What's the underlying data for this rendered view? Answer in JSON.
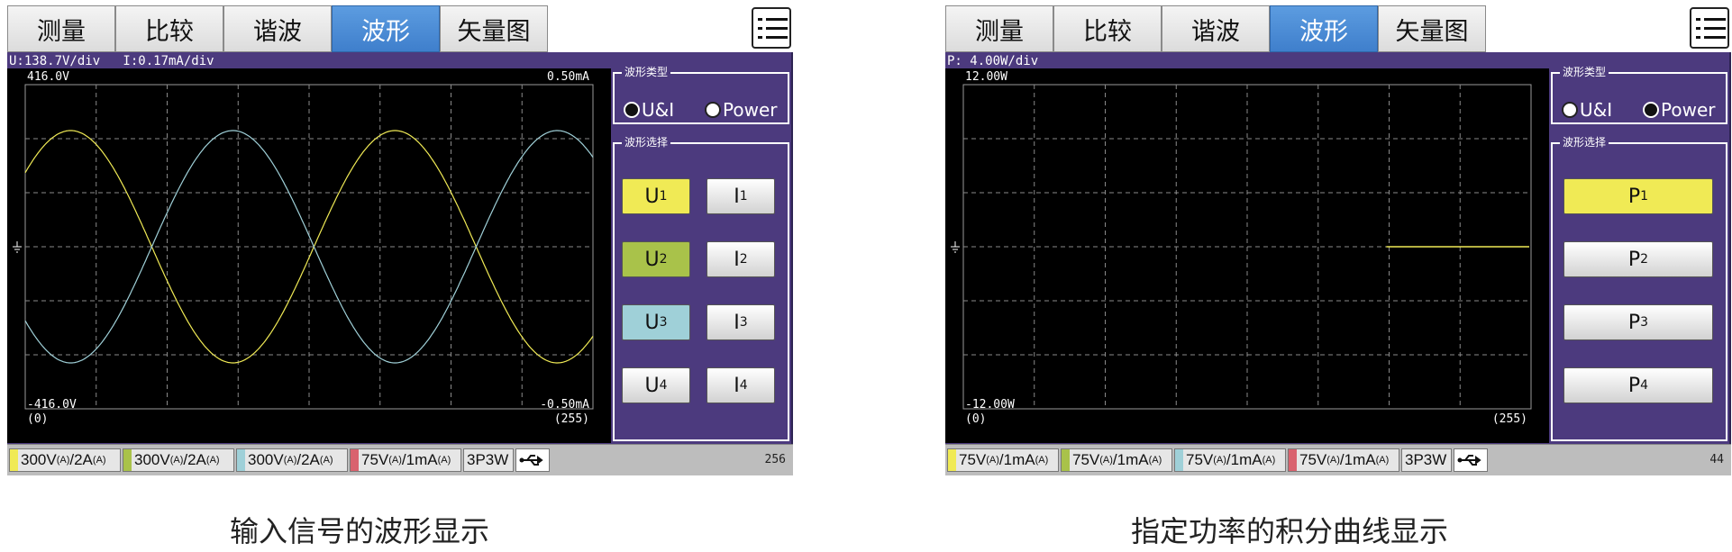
{
  "colors": {
    "u1": "#f0ea55",
    "u2": "#a9c24a",
    "u3": "#9fd0d8",
    "u4": "#cfcfcf",
    "purple": "#4c3a7e",
    "accent_tab": "#4a8ad6",
    "red_swatch": "#d9626e"
  },
  "tabs": [
    "测量",
    "比较",
    "谐波",
    "波形",
    "矢量图"
  ],
  "active_tab": "波形",
  "menu_icon": "list-menu-icon",
  "left": {
    "scale_text": "U:138.7V/div   I:0.17mA/div",
    "top_left": "416.0V",
    "top_right": "0.50mA",
    "bottom_left": "-416.0V",
    "bottom_right": "-0.50mA",
    "x_start": "(0)",
    "x_end": "(255)",
    "wave_type_title": "波形类型",
    "radio_ui": "U&I",
    "radio_power": "Power",
    "selected_type": "U&I",
    "wave_select_title": "波形选择",
    "buttons": [
      {
        "base": "U",
        "sub": "1"
      },
      {
        "base": "I",
        "sub": "1"
      },
      {
        "base": "U",
        "sub": "2"
      },
      {
        "base": "I",
        "sub": "2"
      },
      {
        "base": "U",
        "sub": "3"
      },
      {
        "base": "I",
        "sub": "3"
      },
      {
        "base": "U",
        "sub": "4"
      },
      {
        "base": "I",
        "sub": "4"
      }
    ],
    "status": [
      {
        "main": "300V",
        "s1": "(A)",
        "mid": "/2A",
        "s2": "(A)"
      },
      {
        "main": "300V",
        "s1": "(A)",
        "mid": "/2A",
        "s2": "(A)"
      },
      {
        "main": "300V",
        "s1": "(A)",
        "mid": "/2A",
        "s2": "(A)"
      },
      {
        "main": "75V",
        "s1": "(A)",
        "mid": "/1mA",
        "s2": "(A)"
      }
    ],
    "wiring": "3P3W",
    "count": "256",
    "caption": "输入信号的波形显示"
  },
  "right": {
    "scale_text": "P: 4.00W/div",
    "top_left": "12.00W",
    "bottom_left": "-12.00W",
    "x_start": "(0)",
    "x_end": "(255)",
    "wave_type_title": "波形类型",
    "radio_ui": "U&I",
    "radio_power": "Power",
    "selected_type": "Power",
    "wave_select_title": "波形选择",
    "buttons": [
      {
        "base": "P",
        "sub": "1"
      },
      {
        "base": "P",
        "sub": "2"
      },
      {
        "base": "P",
        "sub": "3"
      },
      {
        "base": "P",
        "sub": "4"
      }
    ],
    "status": [
      {
        "main": "75V",
        "s1": "(A)",
        "mid": "/1mA",
        "s2": "(A)"
      },
      {
        "main": "75V",
        "s1": "(A)",
        "mid": "/1mA",
        "s2": "(A)"
      },
      {
        "main": "75V",
        "s1": "(A)",
        "mid": "/1mA",
        "s2": "(A)"
      },
      {
        "main": "75V",
        "s1": "(A)",
        "mid": "/1mA",
        "s2": "(A)"
      }
    ],
    "wiring": "3P3W",
    "count": "44",
    "caption": "指定功率的积分曲线显示"
  }
}
